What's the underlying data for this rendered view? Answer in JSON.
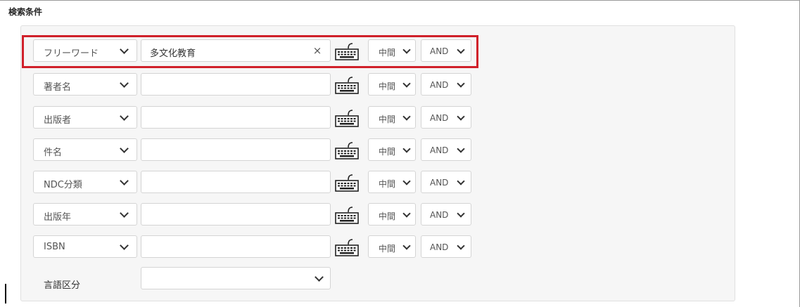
{
  "section_title": "検索条件",
  "keyboard_icon": "keyboard-icon",
  "clear_icon": "close-icon",
  "rows": [
    {
      "field": "フリーワード",
      "value": "多文化教育",
      "match": "中間",
      "operator": "AND",
      "has_clear": true
    },
    {
      "field": "著者名",
      "value": "",
      "match": "中間",
      "operator": "AND",
      "has_clear": false
    },
    {
      "field": "出版者",
      "value": "",
      "match": "中間",
      "operator": "AND",
      "has_clear": false
    },
    {
      "field": "件名",
      "value": "",
      "match": "中間",
      "operator": "AND",
      "has_clear": false
    },
    {
      "field": "NDC分類",
      "value": "",
      "match": "中間",
      "operator": "AND",
      "has_clear": false
    },
    {
      "field": "出版年",
      "value": "",
      "match": "中間",
      "operator": "AND",
      "has_clear": false
    },
    {
      "field": "ISBN",
      "value": "",
      "match": "中間",
      "operator": "AND",
      "has_clear": false
    }
  ],
  "language": {
    "label": "言語区分",
    "value": ""
  },
  "clear_symbol": "×",
  "colors": {
    "highlight": "#d0202a",
    "panel_bg": "#f6f6f6",
    "border": "#d4d4d4"
  }
}
